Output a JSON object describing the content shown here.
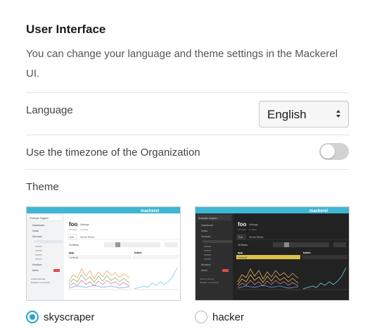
{
  "section": {
    "title": "User Interface",
    "description": "You can change your language and theme settings in the Mackerel UI."
  },
  "language": {
    "label": "Language",
    "selected": "English"
  },
  "timezone": {
    "label": "Use the timezone of the Organization",
    "enabled": false
  },
  "theme": {
    "label": "Theme",
    "options": [
      {
        "name": "skyscraper",
        "selected": true
      },
      {
        "name": "hacker",
        "selected": false
      }
    ],
    "preview": {
      "logo": "mackerel",
      "org": "Example Organiz...",
      "service": "foo",
      "settings": "Settings",
      "meta": [
        "19 hosts",
        "1 invites"
      ],
      "tabs": [
        "Role",
        "Service Metrics"
      ],
      "roles_count": "19 Roles",
      "nav": [
        "Dashboard",
        "Hosts",
        "Services",
        "Monitors",
        "Alerts"
      ],
      "nav_sub": [
        "Getting Started",
        "Register a new Host"
      ],
      "panels": [
        "app",
        "batch"
      ],
      "panel_tag": "loadavg5"
    }
  },
  "colors": {
    "accent": "#24a8c7",
    "logo_bar": "#3fb6d4",
    "hacker_bg": "#222222"
  }
}
